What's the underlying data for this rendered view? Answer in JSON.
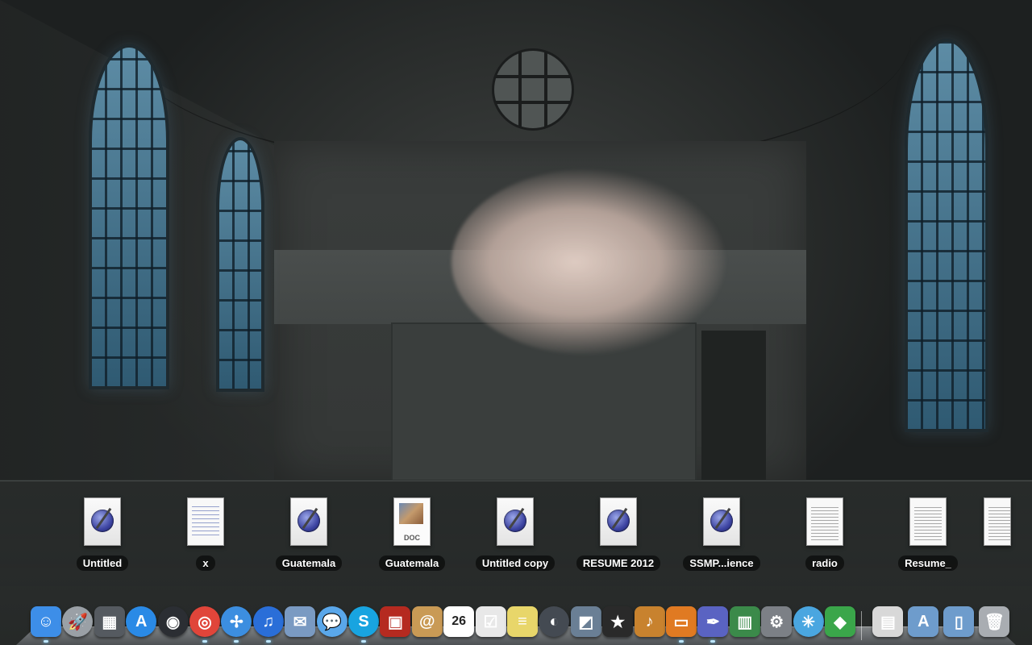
{
  "desktop": {
    "wallpaper": "hall-with-cloud"
  },
  "stack": {
    "items": [
      {
        "label": "Untitled",
        "icon": "pages-document-icon"
      },
      {
        "label": "x",
        "icon": "text-document-icon"
      },
      {
        "label": "Guatemala",
        "icon": "pages-document-icon"
      },
      {
        "label": "Guatemala",
        "icon": "doc-document-icon",
        "badge": "DOC"
      },
      {
        "label": "Untitled copy",
        "icon": "pages-document-icon"
      },
      {
        "label": "RESUME 2012",
        "icon": "pages-document-icon"
      },
      {
        "label": "SSMP...ience",
        "icon": "pages-document-icon"
      },
      {
        "label": "radio",
        "icon": "text-document-icon"
      },
      {
        "label": "Resume_",
        "icon": "text-document-icon"
      }
    ]
  },
  "dock": {
    "items": [
      {
        "name": "finder-icon",
        "glyph": "☺",
        "color": "#3d8ee8",
        "running": true
      },
      {
        "name": "launchpad-icon",
        "glyph": "🚀",
        "color": "#9aa0a6",
        "running": false
      },
      {
        "name": "mission-control-icon",
        "glyph": "▦",
        "color": "#555a60",
        "running": false
      },
      {
        "name": "app-store-icon",
        "glyph": "A",
        "color": "#2a8ae6",
        "running": false
      },
      {
        "name": "dashboard-icon",
        "glyph": "◉",
        "color": "#2b2e33",
        "running": false
      },
      {
        "name": "chrome-icon",
        "glyph": "◎",
        "color": "#e0453a",
        "running": true
      },
      {
        "name": "safari-icon",
        "glyph": "✢",
        "color": "#3c8ee0",
        "running": true
      },
      {
        "name": "itunes-icon",
        "glyph": "♫",
        "color": "#2a6ed8",
        "running": true
      },
      {
        "name": "mail-icon",
        "glyph": "✉",
        "color": "#7a9ac2",
        "running": false
      },
      {
        "name": "messages-icon",
        "glyph": "💬",
        "color": "#5aa7ea",
        "running": false
      },
      {
        "name": "skype-icon",
        "glyph": "S",
        "color": "#18a4e0",
        "running": true
      },
      {
        "name": "photo-booth-icon",
        "glyph": "▣",
        "color": "#b52a20",
        "running": false
      },
      {
        "name": "contacts-icon",
        "glyph": "@",
        "color": "#c99a55",
        "running": false
      },
      {
        "name": "calendar-icon",
        "glyph": "26",
        "color": "#ffffff",
        "running": false
      },
      {
        "name": "reminders-icon",
        "glyph": "☑",
        "color": "#e8e8e8",
        "running": false
      },
      {
        "name": "stickies-icon",
        "glyph": "≡",
        "color": "#e8d66a",
        "running": false
      },
      {
        "name": "facetime-icon",
        "glyph": "◐",
        "color": "#444a52",
        "running": false
      },
      {
        "name": "iphoto-icon",
        "glyph": "◩",
        "color": "#6a7f95",
        "running": false
      },
      {
        "name": "imovie-icon",
        "glyph": "★",
        "color": "#2a2a2a",
        "running": false
      },
      {
        "name": "garageband-icon",
        "glyph": "♪",
        "color": "#c8822e",
        "running": false
      },
      {
        "name": "keynote-icon",
        "glyph": "▭",
        "color": "#e07a22",
        "running": true
      },
      {
        "name": "pages-icon",
        "glyph": "✒",
        "color": "#5a63c2",
        "running": true
      },
      {
        "name": "numbers-icon",
        "glyph": "▥",
        "color": "#3b8a4a",
        "running": false
      },
      {
        "name": "system-preferences-icon",
        "glyph": "⚙",
        "color": "#7c8086",
        "running": false
      },
      {
        "name": "network-utility-icon",
        "glyph": "✳",
        "color": "#4aa6e0",
        "running": false
      },
      {
        "name": "the-sims-icon",
        "glyph": "◆",
        "color": "#3aa64a",
        "running": false
      }
    ],
    "right_items": [
      {
        "name": "document-stack-icon",
        "glyph": "▤",
        "color": "#d8d8d8"
      },
      {
        "name": "applications-folder-icon",
        "glyph": "A",
        "color": "#6e9ccc"
      },
      {
        "name": "documents-folder-icon",
        "glyph": "▯",
        "color": "#6e9ccc"
      },
      {
        "name": "trash-icon",
        "glyph": "🗑",
        "color": "#a9adb2"
      }
    ]
  }
}
